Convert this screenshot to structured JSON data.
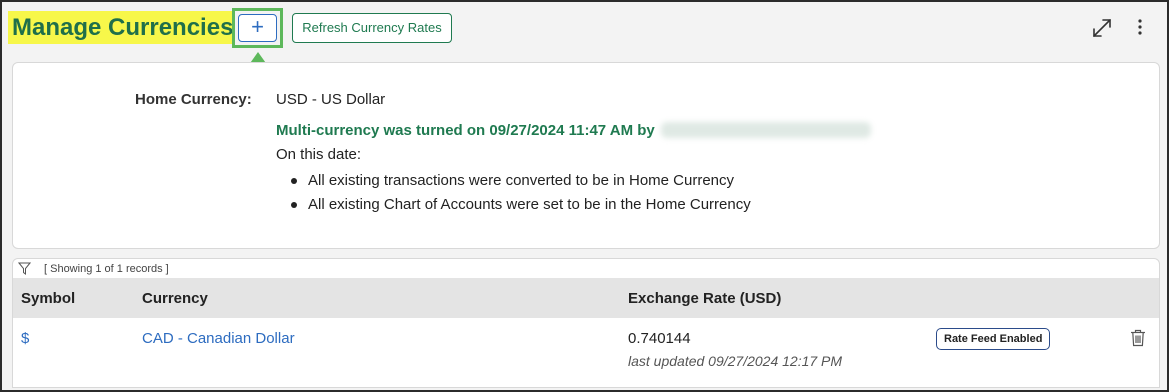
{
  "header": {
    "title": "Manage Currencies",
    "add_label": "+",
    "refresh_label": "Refresh Currency Rates",
    "expand_icon": "expand-icon",
    "more_icon": "kebab-menu-icon"
  },
  "info": {
    "home_label": "Home Currency:",
    "home_value": "USD - US Dollar",
    "multicurrency_text": "Multi-currency was turned on 09/27/2024 11:47 AM by",
    "on_date": "On this date:",
    "bullets": [
      "All existing transactions were converted to be in Home Currency",
      "All existing Chart of Accounts were set to be in the Home Currency"
    ]
  },
  "table": {
    "records_label": "[ Showing 1 of 1 records ]",
    "columns": [
      "Symbol",
      "Currency",
      "Exchange Rate (USD)"
    ],
    "rows": [
      {
        "symbol": "$",
        "currency": "CAD - Canadian Dollar",
        "rate": "0.740144",
        "updated": "last updated 09/27/2024 12:17 PM",
        "badge": "Rate Feed Enabled"
      }
    ]
  },
  "colors": {
    "title_highlight": "#f7f74a",
    "title_text": "#1f6f4a",
    "accent_green": "#1f7a50",
    "link_blue": "#2d6cc0",
    "callout_green": "#5db85b"
  }
}
